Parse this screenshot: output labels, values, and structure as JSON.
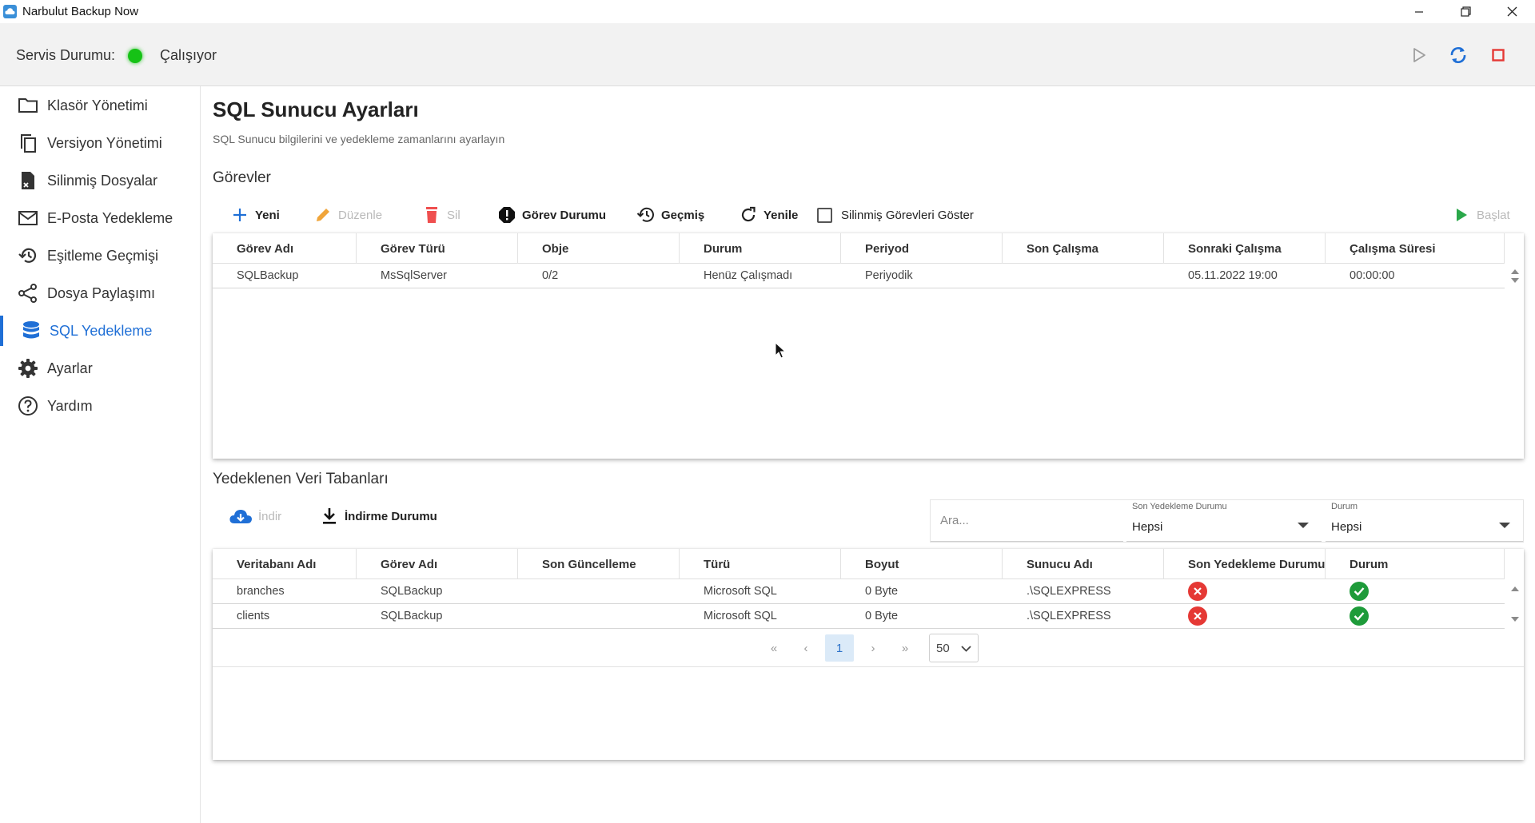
{
  "window": {
    "title": "Narbulut Backup Now",
    "controls": [
      "minimize",
      "restore",
      "close"
    ]
  },
  "service": {
    "label": "Servis Durumu:",
    "status": "Çalışıyor",
    "status_color": "#16c216",
    "actions": [
      {
        "icon": "play-icon",
        "color": "#9e9e9e"
      },
      {
        "icon": "refresh-icon",
        "color": "#1f6fd6"
      },
      {
        "icon": "stop-icon",
        "color": "#e53935"
      }
    ]
  },
  "sidebar": {
    "items": [
      {
        "label": "Klasör Yönetimi",
        "icon": "folder-icon"
      },
      {
        "label": "Versiyon Yönetimi",
        "icon": "copy-icon"
      },
      {
        "label": "Silinmiş Dosyalar",
        "icon": "deleted-file-icon"
      },
      {
        "label": "E-Posta Yedekleme",
        "icon": "mail-icon"
      },
      {
        "label": "Eşitleme Geçmişi",
        "icon": "history-icon"
      },
      {
        "label": "Dosya Paylaşımı",
        "icon": "share-icon"
      },
      {
        "label": "SQL Yedekleme",
        "icon": "database-icon",
        "active": true
      },
      {
        "label": "Ayarlar",
        "icon": "gear-icon"
      },
      {
        "label": "Yardım",
        "icon": "help-icon"
      }
    ],
    "accent": "#1f6fd6"
  },
  "page": {
    "title": "SQL Sunucu Ayarları",
    "subtitle": "SQL Sunucu bilgilerini ve yedekleme zamanlarını ayarlayın"
  },
  "tasks": {
    "section_title": "Görevler",
    "toolbar": {
      "new": "Yeni",
      "edit": "Düzenle",
      "delete": "Sil",
      "task_status": "Görev Durumu",
      "history": "Geçmiş",
      "refresh": "Yenile",
      "show_deleted": "Silinmiş Görevleri Göster",
      "start": "Başlat"
    },
    "columns": [
      "Görev Adı",
      "Görev Türü",
      "Obje",
      "Durum",
      "Periyod",
      "Son Çalışma",
      "Sonraki Çalışma",
      "Çalışma Süresi"
    ],
    "rows": [
      [
        "SQLBackup",
        "MsSqlServer",
        "0/2",
        "Henüz Çalışmadı",
        "Periyodik",
        "",
        "05.11.2022 19:00",
        "00:00:00"
      ]
    ]
  },
  "databases": {
    "section_title": "Yedeklenen Veri Tabanları",
    "toolbar": {
      "download": "İndir",
      "download_status": "İndirme Durumu"
    },
    "search": {
      "placeholder": "Ara...",
      "value": ""
    },
    "filters": [
      {
        "caption": "Son Yedekleme Durumu",
        "value": "Hepsi"
      },
      {
        "caption": "Durum",
        "value": "Hepsi"
      }
    ],
    "columns": [
      "Veritabanı Adı",
      "Görev Adı",
      "Son Güncelleme",
      "Türü",
      "Boyut",
      "Sunucu Adı",
      "Son Yedekleme Durumu",
      "Durum"
    ],
    "rows": [
      {
        "cells": [
          "branches",
          "SQLBackup",
          "",
          "Microsoft SQL",
          "0 Byte",
          ".\\SQLEXPRESS"
        ],
        "last_backup_status": "error",
        "status": "ok"
      },
      {
        "cells": [
          "clients",
          "SQLBackup",
          "",
          "Microsoft SQL",
          "0 Byte",
          ".\\SQLEXPRESS"
        ],
        "last_backup_status": "error",
        "status": "ok"
      }
    ],
    "status_colors": {
      "error": "#e53935",
      "ok": "#1e9b3a"
    },
    "pager": {
      "buttons": [
        "«",
        "‹",
        "›",
        "»"
      ],
      "current_page": "1",
      "page_size": "50"
    }
  }
}
